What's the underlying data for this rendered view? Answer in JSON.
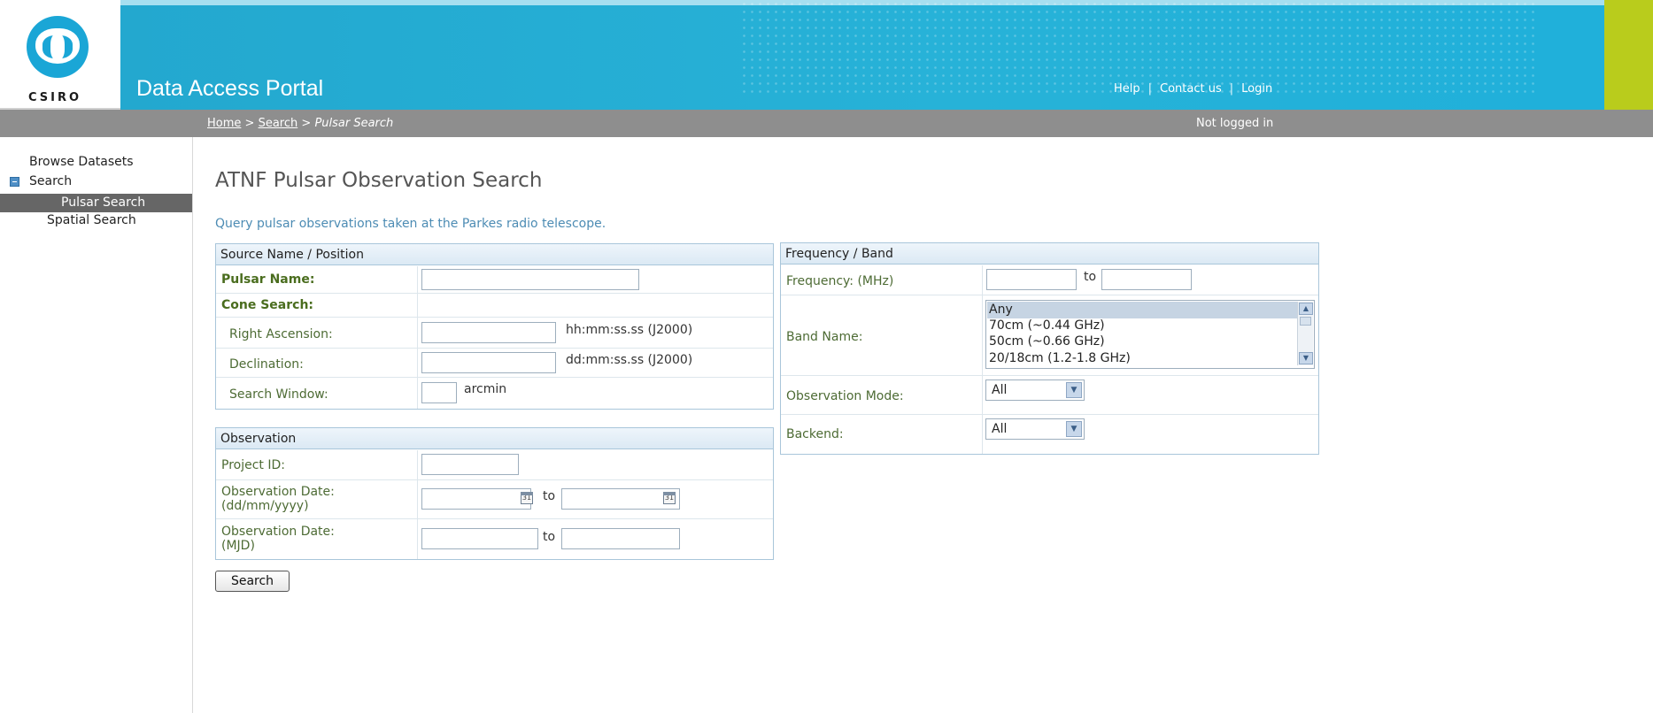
{
  "brand": {
    "logo_text": "CSIRO",
    "title": "Data Access Portal"
  },
  "top_links": {
    "help": "Help",
    "contact": "Contact us",
    "login": "Login"
  },
  "breadcrumb": {
    "home": "Home",
    "sep1": ">",
    "search": "Search",
    "sep2": ">",
    "current": "Pulsar Search"
  },
  "login_status": "Not logged in",
  "sidebar": {
    "browse": "Browse Datasets",
    "search": "Search",
    "pulsar": "Pulsar Search",
    "spatial": "Spatial Search"
  },
  "page": {
    "title": "ATNF Pulsar Observation Search",
    "description": "Query pulsar observations taken at the Parkes radio telescope."
  },
  "source_panel": {
    "heading": "Source Name / Position",
    "pulsar_name": "Pulsar Name:",
    "cone_search": "Cone Search:",
    "ra": "Right Ascension:",
    "ra_unit": "hh:mm:ss.ss (J2000)",
    "dec": "Declination:",
    "dec_unit": "dd:mm:ss.ss (J2000)",
    "window": "Search Window:",
    "window_unit": "arcmin"
  },
  "observation_panel": {
    "heading": "Observation",
    "project_id": "Project ID:",
    "date_label_1": "Observation Date:",
    "date_format_1": "(dd/mm/yyyy)",
    "to": "to",
    "date_label_2": "Observation Date:",
    "date_format_2": "(MJD)",
    "calendar_glyph": "31"
  },
  "frequency_panel": {
    "heading": "Frequency / Band",
    "frequency": "Frequency: (MHz)",
    "to": "to",
    "band_name": "Band Name:",
    "band_options": [
      "Any",
      "70cm (~0.44 GHz)",
      "50cm (~0.66 GHz)",
      "20/18cm (1.2-1.8 GHz)"
    ],
    "band_selected": "Any",
    "obs_mode": "Observation Mode:",
    "obs_mode_value": "All",
    "backend": "Backend:",
    "backend_value": "All"
  },
  "search_button": "Search",
  "colors": {
    "banner": "#27b2d8",
    "lime": "#b9cc1c",
    "crumbbar": "#8e8e8e",
    "label_green": "#4a6d1e"
  }
}
